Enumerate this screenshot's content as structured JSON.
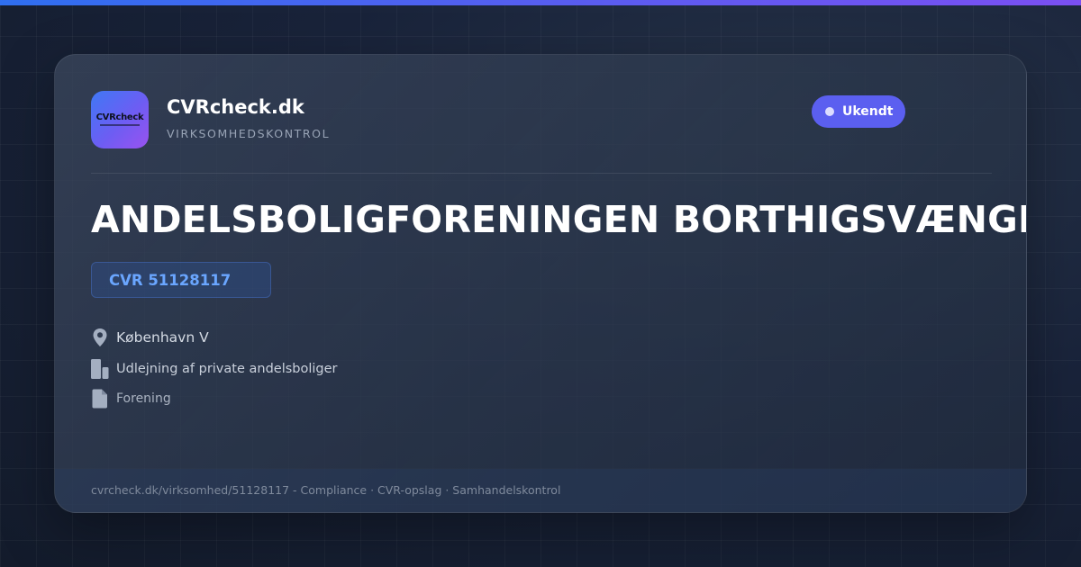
{
  "brand": {
    "logo_text": "CVRcheck",
    "name": "CVRcheck.dk",
    "tagline": "VIRKSOMHEDSKONTROL"
  },
  "status": {
    "label": "Ukendt",
    "color": "#5b5ff0"
  },
  "company": {
    "name": "ANDELSBOLIGFORENINGEN BORTHIGSVÆNGE",
    "cvr_label": "CVR 51128117",
    "location": "København V",
    "industry": "Udlejning af private andelsboliger",
    "legal_form": "Forening"
  },
  "icons": {
    "location": "map-pin-icon",
    "industry": "building-icon",
    "legal_form": "document-icon"
  },
  "footer": {
    "text": "cvrcheck.dk/virksomhed/51128117 - Compliance · CVR-opslag · Samhandelskontrol"
  },
  "colors": {
    "accent_blue": "#2f6ff0",
    "accent_purple": "#7b4ff2",
    "cvr_text": "#6aa6ff",
    "background": "#161f30"
  }
}
